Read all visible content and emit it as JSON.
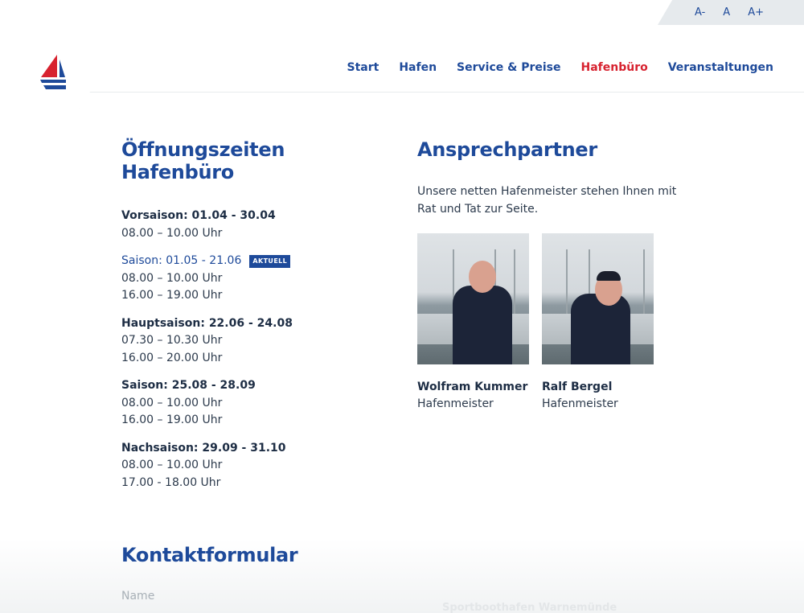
{
  "font_controls": {
    "smaller": "A-",
    "normal": "A",
    "larger": "A+"
  },
  "nav": {
    "items": [
      {
        "label": "Start",
        "active": false
      },
      {
        "label": "Hafen",
        "active": false
      },
      {
        "label": "Service & Preise",
        "active": false
      },
      {
        "label": "Hafenbüro",
        "active": true
      },
      {
        "label": "Veranstaltungen",
        "active": false
      }
    ]
  },
  "colors": {
    "brand_blue": "#1e4a9a",
    "accent_red": "#d7222f"
  },
  "hours": {
    "title": "Öffnungszeiten Hafenbüro",
    "badge": "AKTUELL",
    "seasons": [
      {
        "title": "Vorsaison: 01.04 - 30.04",
        "times": [
          "08.00 – 10.00 Uhr"
        ]
      },
      {
        "title": "Saison: 01.05 - 21.06",
        "times": [
          "08.00 – 10.00 Uhr",
          "16.00 – 19.00 Uhr"
        ],
        "current": true
      },
      {
        "title": "Hauptsaison: 22.06 - 24.08",
        "times": [
          "07.30 – 10.30 Uhr",
          "16.00 – 20.00 Uhr"
        ]
      },
      {
        "title": "Saison: 25.08 - 28.09",
        "times": [
          "08.00 – 10.00 Uhr",
          "16.00 – 19.00 Uhr"
        ]
      },
      {
        "title": "Nachsaison: 29.09 - 31.10",
        "times": [
          "08.00 – 10.00 Uhr",
          "17.00 - 18.00 Uhr"
        ]
      }
    ]
  },
  "contacts": {
    "title": "Ansprechpartner",
    "intro": "Unsere netten Hafenmeister stehen Ihnen mit Rat und Tat zur Seite.",
    "people": [
      {
        "name": "Wolfram Kummer",
        "role": "Hafenmeister"
      },
      {
        "name": "Ralf Bergel",
        "role": "Hafenmeister"
      }
    ]
  },
  "form": {
    "title": "Kontaktformular",
    "name_label": "Name"
  },
  "footer_ghost": "Sportboothafen Warnemünde"
}
